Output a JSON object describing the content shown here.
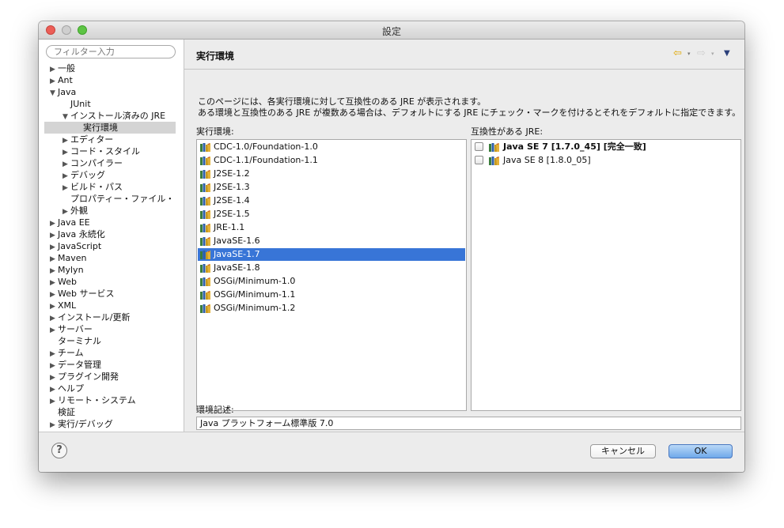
{
  "window": {
    "title": "設定",
    "traffic_lights": {
      "close": "#ec5e57",
      "minimize": "#bdbdbd",
      "zoom": "#5dc444"
    }
  },
  "filter": {
    "placeholder": "フィルター入力"
  },
  "tree": [
    {
      "label": "一般",
      "arrow": "right",
      "level": 0
    },
    {
      "label": "Ant",
      "arrow": "right",
      "level": 0
    },
    {
      "label": "Java",
      "arrow": "down",
      "level": 0
    },
    {
      "label": "JUnit",
      "arrow": "none",
      "level": 1
    },
    {
      "label": "インストール済みの JRE",
      "arrow": "down",
      "level": 1
    },
    {
      "label": "実行環境",
      "arrow": "none",
      "level": 2,
      "selected": true
    },
    {
      "label": "エディター",
      "arrow": "right",
      "level": 1
    },
    {
      "label": "コード・スタイル",
      "arrow": "right",
      "level": 1
    },
    {
      "label": "コンパイラー",
      "arrow": "right",
      "level": 1
    },
    {
      "label": "デバッグ",
      "arrow": "right",
      "level": 1
    },
    {
      "label": "ビルド・パス",
      "arrow": "right",
      "level": 1
    },
    {
      "label": "プロパティー・ファイル・",
      "arrow": "none",
      "level": 1
    },
    {
      "label": "外観",
      "arrow": "right",
      "level": 1
    },
    {
      "label": "Java EE",
      "arrow": "right",
      "level": 0
    },
    {
      "label": "Java 永続化",
      "arrow": "right",
      "level": 0
    },
    {
      "label": "JavaScript",
      "arrow": "right",
      "level": 0
    },
    {
      "label": "Maven",
      "arrow": "right",
      "level": 0
    },
    {
      "label": "Mylyn",
      "arrow": "right",
      "level": 0
    },
    {
      "label": "Web",
      "arrow": "right",
      "level": 0
    },
    {
      "label": "Web サービス",
      "arrow": "right",
      "level": 0
    },
    {
      "label": "XML",
      "arrow": "right",
      "level": 0
    },
    {
      "label": "インストール/更新",
      "arrow": "right",
      "level": 0
    },
    {
      "label": "サーバー",
      "arrow": "right",
      "level": 0
    },
    {
      "label": "ターミナル",
      "arrow": "none",
      "level": 0
    },
    {
      "label": "チーム",
      "arrow": "right",
      "level": 0
    },
    {
      "label": "データ管理",
      "arrow": "right",
      "level": 0
    },
    {
      "label": "プラグイン開発",
      "arrow": "right",
      "level": 0
    },
    {
      "label": "ヘルプ",
      "arrow": "right",
      "level": 0
    },
    {
      "label": "リモート・システム",
      "arrow": "right",
      "level": 0
    },
    {
      "label": "検証",
      "arrow": "none",
      "level": 0
    },
    {
      "label": "実行/デバッグ",
      "arrow": "right",
      "level": 0
    }
  ],
  "page": {
    "title": "実行環境",
    "nav": {
      "back_icon": "back-arrow-icon",
      "forward_icon": "forward-arrow-icon",
      "menu_icon": "view-menu-icon"
    },
    "description_line1": "このページには、各実行環境に対して互換性のある JRE が表示されます。",
    "description_line2": "ある環境と互換性のある JRE が複数ある場合は、デフォルトにする JRE にチェック・マークを付けるとそれをデフォルトに指定できます。",
    "env_label": "実行環境:",
    "jre_label": "互換性がある JRE:",
    "environments": [
      {
        "name": "CDC-1.0/Foundation-1.0"
      },
      {
        "name": "CDC-1.1/Foundation-1.1"
      },
      {
        "name": "J2SE-1.2"
      },
      {
        "name": "J2SE-1.3"
      },
      {
        "name": "J2SE-1.4"
      },
      {
        "name": "J2SE-1.5"
      },
      {
        "name": "JRE-1.1"
      },
      {
        "name": "JavaSE-1.6"
      },
      {
        "name": "JavaSE-1.7",
        "selected": true
      },
      {
        "name": "JavaSE-1.8"
      },
      {
        "name": "OSGi/Minimum-1.0"
      },
      {
        "name": "OSGi/Minimum-1.1"
      },
      {
        "name": "OSGi/Minimum-1.2"
      }
    ],
    "jres": [
      {
        "name": "Java SE 7 [1.7.0_45] [完全一致]",
        "bold": true,
        "checked": false
      },
      {
        "name": "Java SE 8 [1.8.0_05]",
        "bold": false,
        "checked": false
      }
    ],
    "env_desc_label": "環境記述:",
    "env_desc_value": "Java プラットフォーム標準版 7.0"
  },
  "footer": {
    "help_icon": "help-icon",
    "help_glyph": "?",
    "cancel_label": "キャンセル",
    "ok_label": "OK"
  },
  "colors": {
    "selection": "#3875d7",
    "tree_selection": "#d4d4d4",
    "ok_button": "#6fa8ea"
  }
}
